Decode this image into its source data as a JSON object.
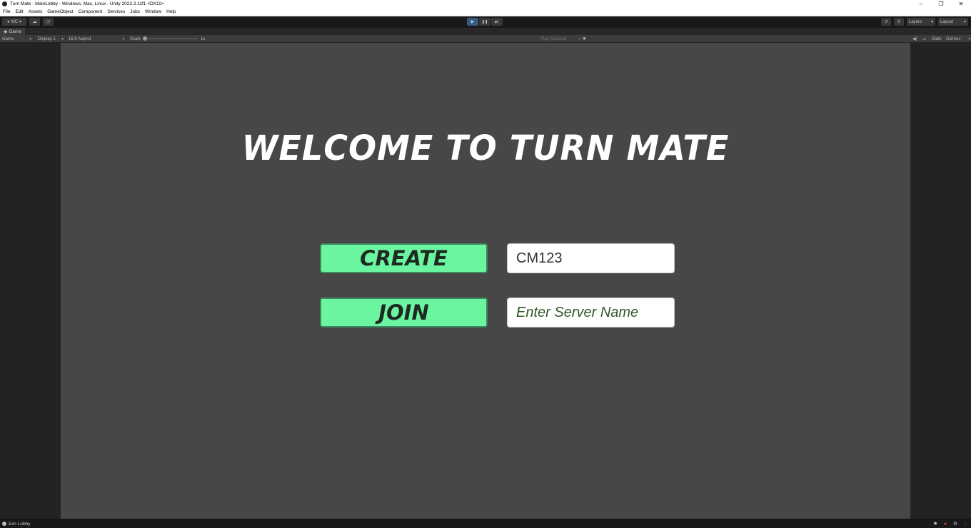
{
  "window": {
    "title": "Turn Mate - MainLobby - Windows, Mac, Linux - Unity 2022.3.11f1 <DX11>",
    "minimize_glyph": "–",
    "maximize_glyph": "❐",
    "close_glyph": "✕"
  },
  "menu": {
    "items": [
      "File",
      "Edit",
      "Assets",
      "GameObject",
      "Component",
      "Services",
      "Jobs",
      "Window",
      "Help"
    ]
  },
  "toolbar": {
    "account_label": "MC",
    "play_glyph": "▶",
    "pause_glyph": "❚❚",
    "step_glyph": "▶|",
    "layers_label": "Layers",
    "layout_label": "Layout"
  },
  "tabs": {
    "game_label": "Game"
  },
  "gamebar": {
    "view_mode": "Game",
    "display": "Display 1",
    "aspect": "16:9 Aspect",
    "scale_label": "Scale",
    "scale_value": 1,
    "scale_text": "1x",
    "play_mode": "Play Focused",
    "stats_label": "Stats",
    "gizmos_label": "Gizmos"
  },
  "game": {
    "title": "WELCOME TO TURN MATE",
    "create_label": "CREATE",
    "join_label": "JOIN",
    "create_input_value": "CM123",
    "join_input_placeholder": "Enter Server Name"
  },
  "status": {
    "text": "Join Lobby"
  },
  "colors": {
    "button_green": "#6cf5a0",
    "canvas_gray": "#474747",
    "editor_dark": "#191919"
  }
}
